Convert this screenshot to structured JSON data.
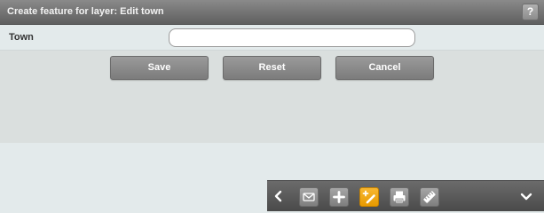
{
  "header": {
    "title": "Create feature for layer: Edit town",
    "help_label": "?"
  },
  "form": {
    "field_label": "Town",
    "field_value": "",
    "field_placeholder": ""
  },
  "buttons": {
    "save": "Save",
    "reset": "Reset",
    "cancel": "Cancel"
  },
  "toolbar": {
    "icons": [
      "chevron-left-icon",
      "mail-icon",
      "add-icon",
      "draw-feature-icon",
      "print-icon",
      "measure-icon",
      "chevron-down-icon"
    ],
    "active_icon": "draw-feature-icon",
    "active_color": "#f2a81d"
  }
}
